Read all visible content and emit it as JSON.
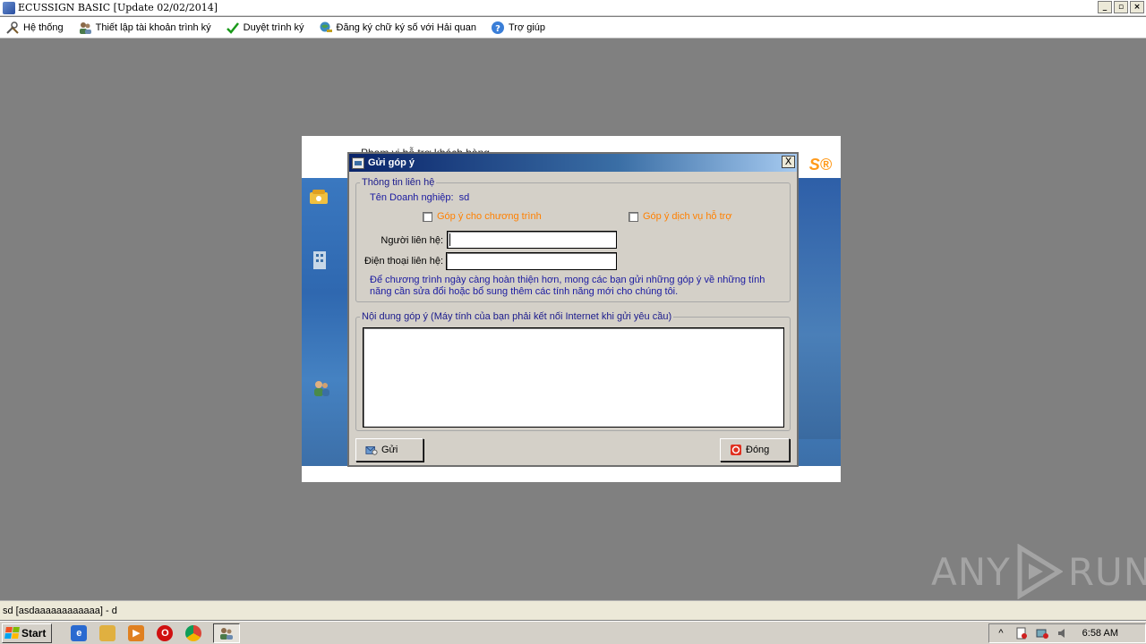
{
  "window": {
    "title": "ECUSSIGN BASIC [Update 02/02/2014]",
    "controls": [
      "_",
      "▫",
      "×"
    ]
  },
  "menu": {
    "items": [
      {
        "label": "Hệ thống",
        "icon": "tools-icon"
      },
      {
        "label": "Thiết lập tài khoản trình ký",
        "icon": "users-icon"
      },
      {
        "label": "Duyệt trình ký",
        "icon": "checkmark-icon"
      },
      {
        "label": "Đăng ký chữ ký số với Hải quan",
        "icon": "globe-key-icon"
      },
      {
        "label": "Trợ giúp",
        "icon": "help-icon"
      }
    ]
  },
  "background_form": {
    "partial_header": "Phạm vi hỗ trợ khách hàng"
  },
  "dialog": {
    "title": "Gửi góp ý",
    "close_label": "X",
    "contact_group": {
      "legend": "Thông tin liên hệ",
      "company_label": "Tên Doanh nghiệp:",
      "company_value": "sd",
      "check_program": "Góp ý cho chương trình",
      "check_service": "Góp ý dịch vụ hỗ trợ",
      "person_label": "Người liên hệ:",
      "person_value": "",
      "phone_label": "Điện thoại liên hệ:",
      "phone_value": "",
      "note": "Để chương trình ngày càng hoàn thiện hơn, mong các bạn gửi những góp ý về những tính năng cần sửa đổi hoặc bổ sung thêm các tính năng mới cho chúng tôi."
    },
    "content_group": {
      "legend": "Nội dung góp ý (Máy tính của bạn phải kết nối Internet khi gửi yêu cầu)",
      "value": ""
    },
    "buttons": {
      "send": "Gửi",
      "close": "Đóng"
    }
  },
  "statusbar": {
    "text": "sd [asdaaaaaaaaaaaa] - d"
  },
  "watermark": {
    "left": "ANY",
    "right": "RUN"
  },
  "taskbar": {
    "start_label": "Start",
    "clock": "6:58 AM"
  },
  "colors": {
    "accent_orange": "#ff8000",
    "label_blue": "#1a1aa0",
    "dialog_bg": "#d4d0c8",
    "desktop_bg": "#808080"
  }
}
